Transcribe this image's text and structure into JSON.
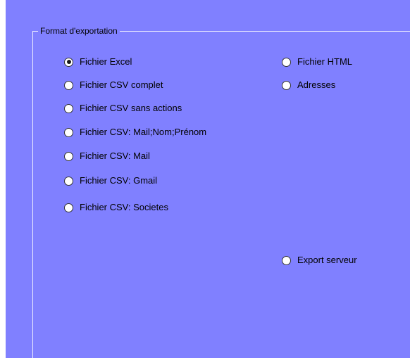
{
  "group": {
    "title": "Format d'exportation"
  },
  "options": {
    "excel": {
      "label": "Fichier Excel",
      "checked": true
    },
    "csv_complet": {
      "label": "Fichier CSV complet",
      "checked": false
    },
    "csv_sans_actions": {
      "label": "Fichier CSV sans actions",
      "checked": false
    },
    "csv_mail_nom_prenom": {
      "label": "Fichier CSV: Mail;Nom;Prénom",
      "checked": false
    },
    "csv_mail": {
      "label": "Fichier CSV: Mail",
      "checked": false
    },
    "csv_gmail": {
      "label": "Fichier CSV: Gmail",
      "checked": false
    },
    "csv_societes": {
      "label": "Fichier CSV: Societes",
      "checked": false
    },
    "html": {
      "label": "Fichier HTML",
      "checked": false
    },
    "adresses": {
      "label": "Adresses",
      "checked": false
    },
    "export_serveur": {
      "label": "Export serveur",
      "checked": false
    }
  },
  "colors": {
    "background": "#8080ff",
    "groupbox_line": "#ececff",
    "radio_fill": "#ffffff"
  }
}
